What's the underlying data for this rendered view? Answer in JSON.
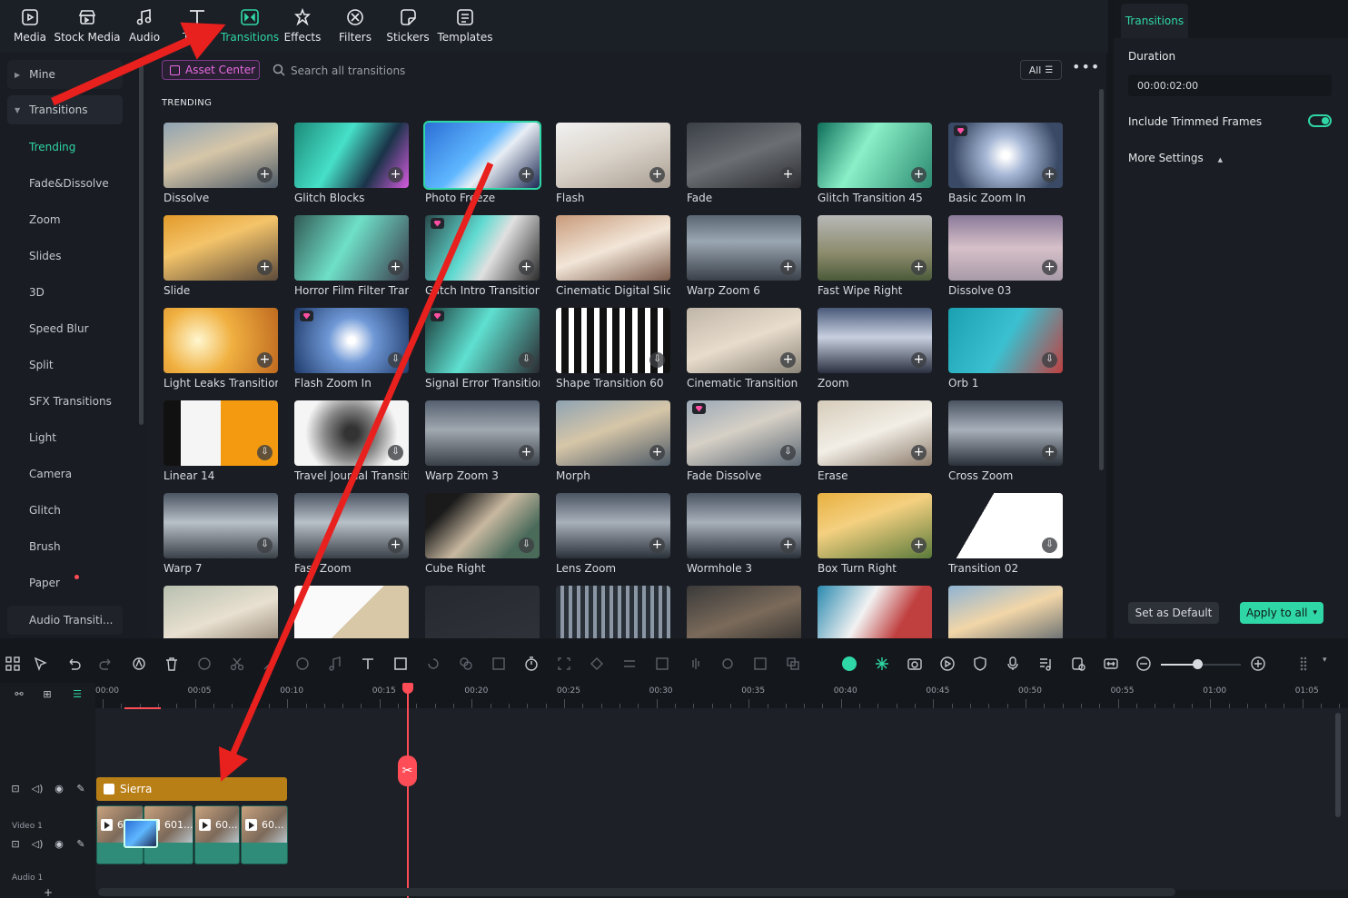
{
  "toolbar": {
    "items": [
      {
        "label": "Media",
        "icon": "media-icon"
      },
      {
        "label": "Stock Media",
        "icon": "stock-media-icon"
      },
      {
        "label": "Audio",
        "icon": "music-note-icon"
      },
      {
        "label": "Titles",
        "icon": "text-t-icon"
      },
      {
        "label": "Transitions",
        "icon": "transitions-icon"
      },
      {
        "label": "Effects",
        "icon": "effects-icon"
      },
      {
        "label": "Filters",
        "icon": "filters-icon"
      },
      {
        "label": "Stickers",
        "icon": "stickers-icon"
      },
      {
        "label": "Templates",
        "icon": "templates-icon"
      }
    ],
    "active": "Transitions"
  },
  "sidebar": {
    "mine": "Mine",
    "transitions": "Transitions",
    "items": [
      "Trending",
      "Fade&Dissolve",
      "Zoom",
      "Slides",
      "3D",
      "Speed Blur",
      "Split",
      "SFX Transitions",
      "Light",
      "Camera",
      "Glitch",
      "Brush",
      "Paper"
    ],
    "audio": "Audio Transiti..."
  },
  "browser": {
    "asset_center": "Asset Center",
    "search_placeholder": "Search all transitions",
    "filter_label": "All",
    "section_title": "TRENDING",
    "tiles": [
      {
        "name": "Dissolve",
        "action": "add"
      },
      {
        "name": "Glitch Blocks",
        "action": "add"
      },
      {
        "name": "Photo Freeze",
        "action": "add",
        "selected": true
      },
      {
        "name": "Flash",
        "action": "add"
      },
      {
        "name": "Fade",
        "action": "add"
      },
      {
        "name": "Glitch Transition 45",
        "action": "add"
      },
      {
        "name": "Basic Zoom In",
        "action": "add",
        "premium": true
      },
      {
        "name": "Slide",
        "action": "add"
      },
      {
        "name": "Horror Film Filter Tran...",
        "action": "add"
      },
      {
        "name": "Glitch Intro Transition ...",
        "action": "add",
        "premium": true
      },
      {
        "name": "Cinematic Digital Slid...",
        "action": "none"
      },
      {
        "name": "Warp Zoom 6",
        "action": "add"
      },
      {
        "name": "Fast Wipe Right",
        "action": "add"
      },
      {
        "name": "Dissolve 03",
        "action": "add"
      },
      {
        "name": "Light Leaks Transition ...",
        "action": "add"
      },
      {
        "name": "Flash Zoom In",
        "action": "download",
        "premium": true
      },
      {
        "name": "Signal Error Transition ...",
        "action": "download",
        "premium": true
      },
      {
        "name": "Shape Transition 60",
        "action": "download"
      },
      {
        "name": "Cinematic Transition 04",
        "action": "add"
      },
      {
        "name": "Zoom",
        "action": "add"
      },
      {
        "name": "Orb 1",
        "action": "download"
      },
      {
        "name": "Linear 14",
        "action": "download"
      },
      {
        "name": "Travel Journal Transiti...",
        "action": "download"
      },
      {
        "name": "Warp Zoom 3",
        "action": "add"
      },
      {
        "name": "Morph",
        "action": "add"
      },
      {
        "name": "Fade Dissolve",
        "action": "download",
        "premium": true
      },
      {
        "name": "Erase",
        "action": "add"
      },
      {
        "name": "Cross Zoom",
        "action": "add"
      },
      {
        "name": "Warp 7",
        "action": "download"
      },
      {
        "name": "Fast Zoom",
        "action": "add"
      },
      {
        "name": "Cube Right",
        "action": "download"
      },
      {
        "name": "Lens Zoom",
        "action": "add"
      },
      {
        "name": "Wormhole 3",
        "action": "add"
      },
      {
        "name": "Box Turn Right",
        "action": "add"
      },
      {
        "name": "Transition 02",
        "action": "download"
      },
      {
        "name": "",
        "action": "none"
      },
      {
        "name": "",
        "action": "none"
      },
      {
        "name": "",
        "action": "none"
      },
      {
        "name": "",
        "action": "none"
      },
      {
        "name": "",
        "action": "none"
      },
      {
        "name": "",
        "action": "none"
      },
      {
        "name": "",
        "action": "none"
      }
    ]
  },
  "panel": {
    "tab": "Transitions",
    "duration_label": "Duration",
    "duration_value": "00:00:02:00",
    "include_trimmed": "Include Trimmed Frames",
    "include_trimmed_on": true,
    "more_settings": "More Settings",
    "set_default": "Set as Default",
    "apply_all": "Apply to all"
  },
  "timeline": {
    "ruler": [
      "00:00",
      "00:05",
      "00:10",
      "00:15",
      "00:20",
      "00:25",
      "00:30",
      "00:35",
      "00:40",
      "00:45",
      "00:50",
      "00:55",
      "01:00",
      "01:05"
    ],
    "title_clip": "Sierra",
    "video_track": "Video 1",
    "audio_track": "Audio 1",
    "clips": [
      "60...",
      "601...",
      "60...",
      "60..."
    ],
    "zoom_level": 0.45
  },
  "colors": {
    "accent": "#2fd6a6",
    "playhead": "#ff4d57",
    "title_clip": "#b97f17",
    "video_clip": "#2f8c78",
    "arrow": "#e8201e"
  }
}
